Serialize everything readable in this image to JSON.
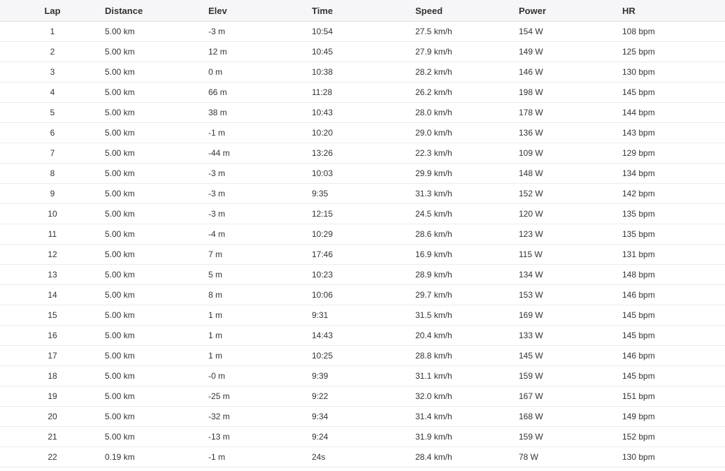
{
  "table": {
    "columns": [
      "Lap",
      "Distance",
      "Elev",
      "Time",
      "Speed",
      "Power",
      "HR"
    ],
    "rows": [
      [
        "1",
        "5.00 km",
        "-3 m",
        "10:54",
        "27.5 km/h",
        "154 W",
        "108 bpm"
      ],
      [
        "2",
        "5.00 km",
        "12 m",
        "10:45",
        "27.9 km/h",
        "149 W",
        "125 bpm"
      ],
      [
        "3",
        "5.00 km",
        "0 m",
        "10:38",
        "28.2 km/h",
        "146 W",
        "130 bpm"
      ],
      [
        "4",
        "5.00 km",
        "66 m",
        "11:28",
        "26.2 km/h",
        "198 W",
        "145 bpm"
      ],
      [
        "5",
        "5.00 km",
        "38 m",
        "10:43",
        "28.0 km/h",
        "178 W",
        "144 bpm"
      ],
      [
        "6",
        "5.00 km",
        "-1 m",
        "10:20",
        "29.0 km/h",
        "136 W",
        "143 bpm"
      ],
      [
        "7",
        "5.00 km",
        "-44 m",
        "13:26",
        "22.3 km/h",
        "109 W",
        "129 bpm"
      ],
      [
        "8",
        "5.00 km",
        "-3 m",
        "10:03",
        "29.9 km/h",
        "148 W",
        "134 bpm"
      ],
      [
        "9",
        "5.00 km",
        "-3 m",
        "9:35",
        "31.3 km/h",
        "152 W",
        "142 bpm"
      ],
      [
        "10",
        "5.00 km",
        "-3 m",
        "12:15",
        "24.5 km/h",
        "120 W",
        "135 bpm"
      ],
      [
        "11",
        "5.00 km",
        "-4 m",
        "10:29",
        "28.6 km/h",
        "123 W",
        "135 bpm"
      ],
      [
        "12",
        "5.00 km",
        "7 m",
        "17:46",
        "16.9 km/h",
        "115 W",
        "131 bpm"
      ],
      [
        "13",
        "5.00 km",
        "5 m",
        "10:23",
        "28.9 km/h",
        "134 W",
        "148 bpm"
      ],
      [
        "14",
        "5.00 km",
        "8 m",
        "10:06",
        "29.7 km/h",
        "153 W",
        "146 bpm"
      ],
      [
        "15",
        "5.00 km",
        "1 m",
        "9:31",
        "31.5 km/h",
        "169 W",
        "145 bpm"
      ],
      [
        "16",
        "5.00 km",
        "1 m",
        "14:43",
        "20.4 km/h",
        "133 W",
        "145 bpm"
      ],
      [
        "17",
        "5.00 km",
        "1 m",
        "10:25",
        "28.8 km/h",
        "145 W",
        "146 bpm"
      ],
      [
        "18",
        "5.00 km",
        "-0 m",
        "9:39",
        "31.1 km/h",
        "159 W",
        "145 bpm"
      ],
      [
        "19",
        "5.00 km",
        "-25 m",
        "9:22",
        "32.0 km/h",
        "167 W",
        "151 bpm"
      ],
      [
        "20",
        "5.00 km",
        "-32 m",
        "9:34",
        "31.4 km/h",
        "168 W",
        "149 bpm"
      ],
      [
        "21",
        "5.00 km",
        "-13 m",
        "9:24",
        "31.9 km/h",
        "159 W",
        "152 bpm"
      ],
      [
        "22",
        "0.19 km",
        "-1 m",
        "24s",
        "28.4 km/h",
        "78 W",
        "130 bpm"
      ]
    ]
  }
}
